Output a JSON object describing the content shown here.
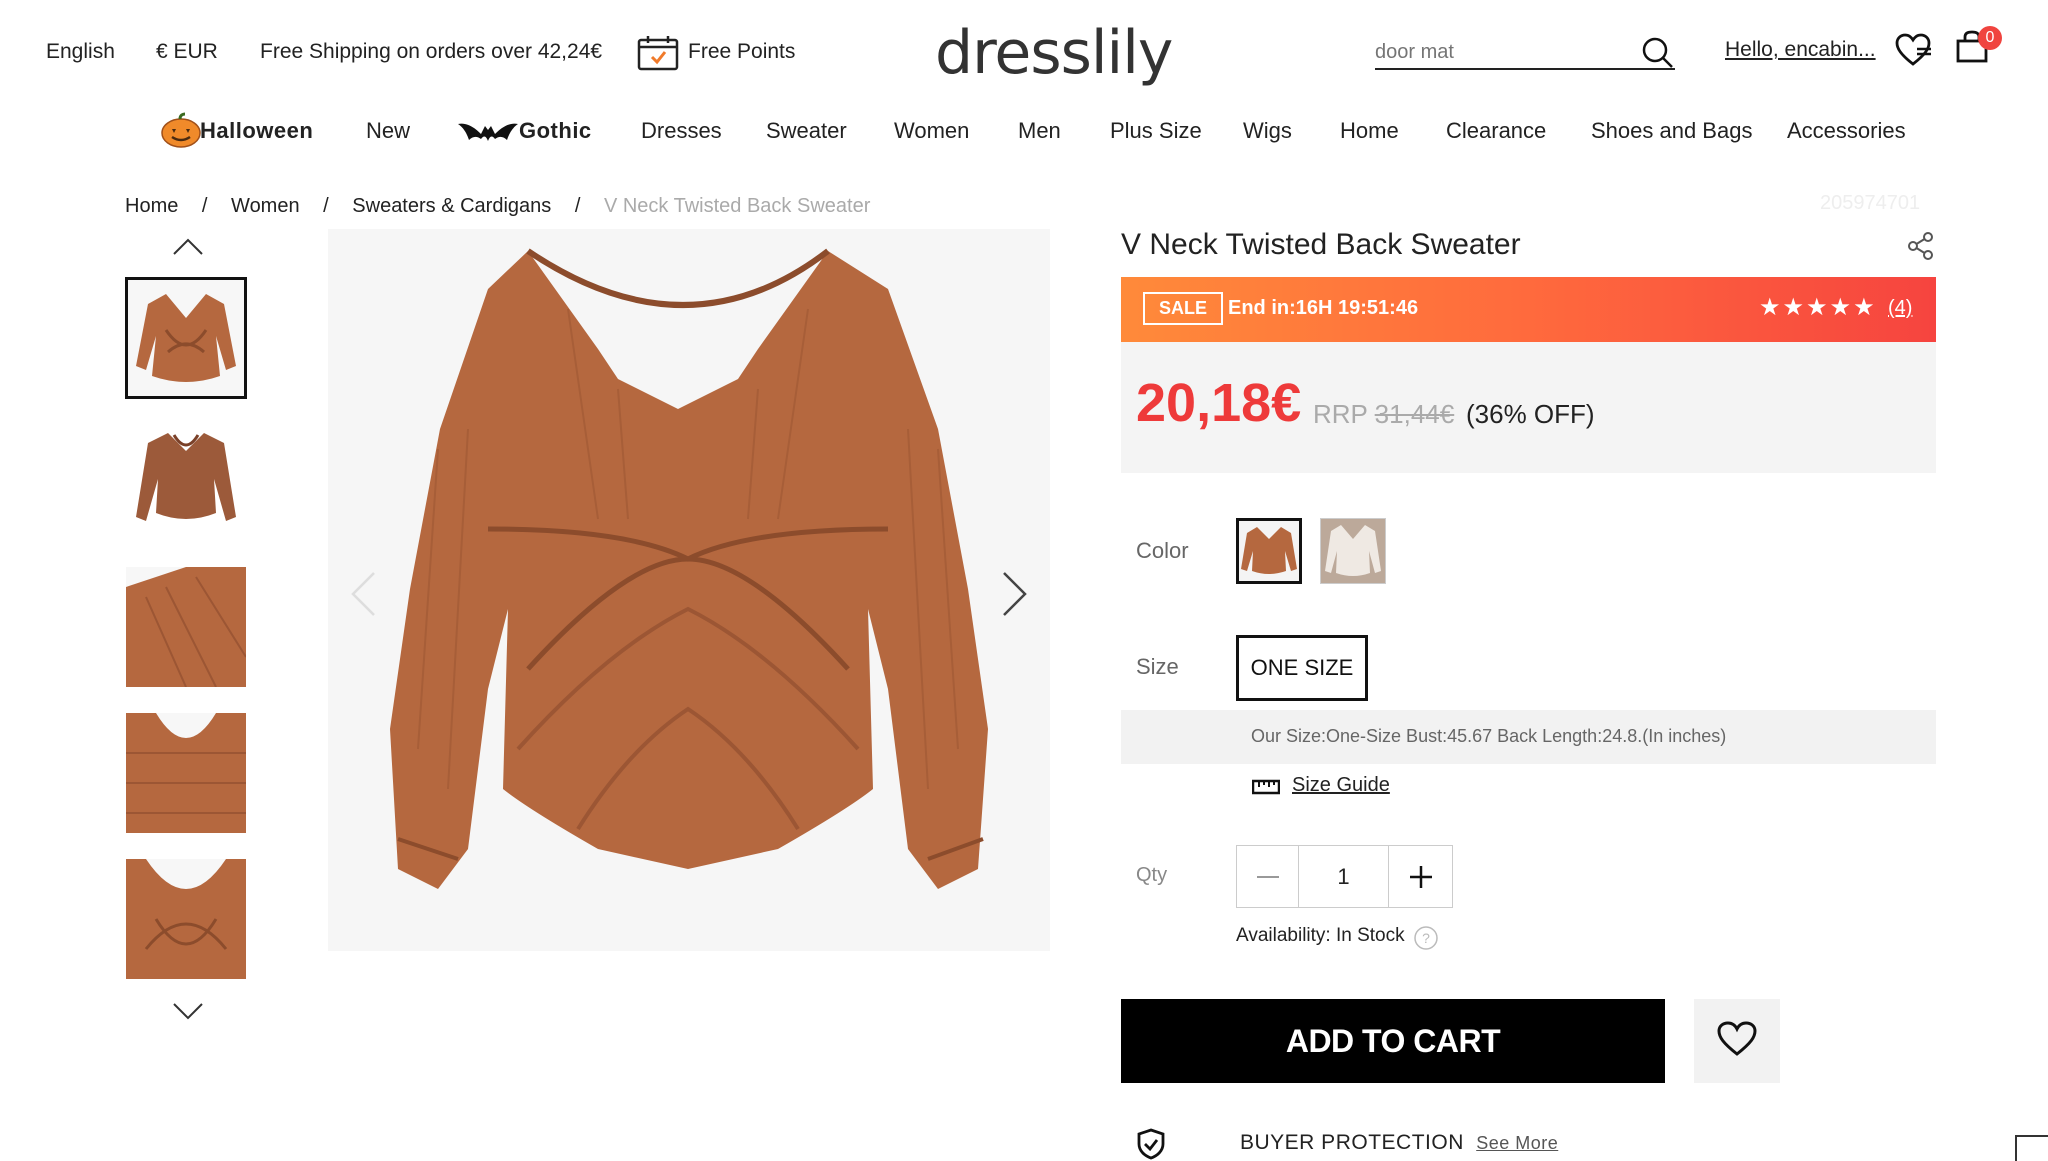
{
  "topbar": {
    "language": "English",
    "currency": "€ EUR",
    "shipping": "Free Shipping on orders over 42,24€",
    "points": "Free Points",
    "logo": "dresslily",
    "search_placeholder": "door mat",
    "greeting": "Hello, encabin...",
    "cart_count": "0"
  },
  "nav": {
    "items": [
      "Halloween",
      "New",
      "Gothic",
      "Dresses",
      "Sweater",
      "Women",
      "Men",
      "Plus Size",
      "Wigs",
      "Home",
      "Clearance",
      "Shoes and Bags",
      "Accessories"
    ]
  },
  "breadcrumb": {
    "items": [
      "Home",
      "Women",
      "Sweaters & Cardigans",
      "V Neck Twisted Back Sweater"
    ],
    "separator": "/"
  },
  "product": {
    "sku": "205974701",
    "title": "V Neck Twisted Back Sweater",
    "sale_tag": "SALE",
    "end_in": "End in:16H 19:51:46",
    "stars": "★★★★★",
    "rating_value": 5,
    "review_count": "(4)",
    "price": "20,18€",
    "rrp_label": "RRP",
    "rrp_value": "31,44€",
    "discount": "(36% OFF)",
    "color_label": "Color",
    "size_label": "Size",
    "size_option": "ONE SIZE",
    "size_info": "Our Size:One-Size   Bust:45.67   Back Length:24.8.(In inches)",
    "size_guide": "Size Guide",
    "qty_label": "Qty",
    "qty_value": "1",
    "availability": "Availability: In Stock",
    "add_to_cart": "ADD TO CART",
    "buyer_protection": "BUYER PROTECTION",
    "see_more": "See More"
  },
  "colors": {
    "accent_red": "#ee3a3a",
    "sale_gradient_start": "#ff8a3a",
    "sale_gradient_end": "#f6443f",
    "sweater_brown": "#b5683f",
    "sweater_white": "#efe9e3"
  }
}
